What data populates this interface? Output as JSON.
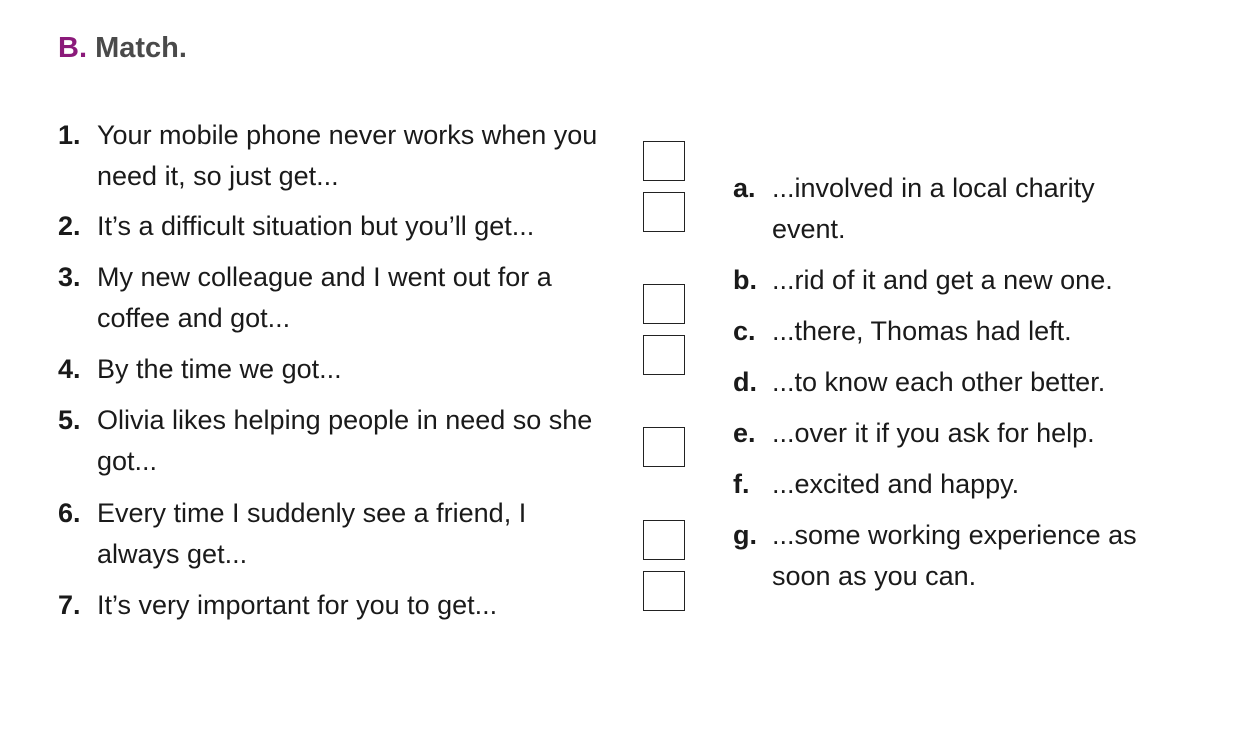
{
  "heading": {
    "letter": "B.",
    "title": "Match."
  },
  "left_items": [
    {
      "num": "1.",
      "text": "Your mobile phone never works when you need it, so just get..."
    },
    {
      "num": "2.",
      "text": "It’s a difficult situation but you’ll get..."
    },
    {
      "num": "3.",
      "text": "My new colleague and I went out for a coffee and got..."
    },
    {
      "num": "4.",
      "text": "By the time we got..."
    },
    {
      "num": "5.",
      "text": "Olivia likes helping people in need so she got..."
    },
    {
      "num": "6.",
      "text": "Every time I suddenly see a friend, I always get..."
    },
    {
      "num": "7.",
      "text": "It’s very important for you to get..."
    }
  ],
  "right_items": [
    {
      "letter": "a.",
      "text": "...involved in a local charity event."
    },
    {
      "letter": "b.",
      "text": "...rid of it and get a new one."
    },
    {
      "letter": "c.",
      "text": "...there, Thomas had left."
    },
    {
      "letter": "d.",
      "text": "...to know each other better."
    },
    {
      "letter": "e.",
      "text": "...over it if you ask for help."
    },
    {
      "letter": "f.",
      "text": "...excited and happy."
    },
    {
      "letter": "g.",
      "text": "...some working experience as soon as you can."
    }
  ]
}
